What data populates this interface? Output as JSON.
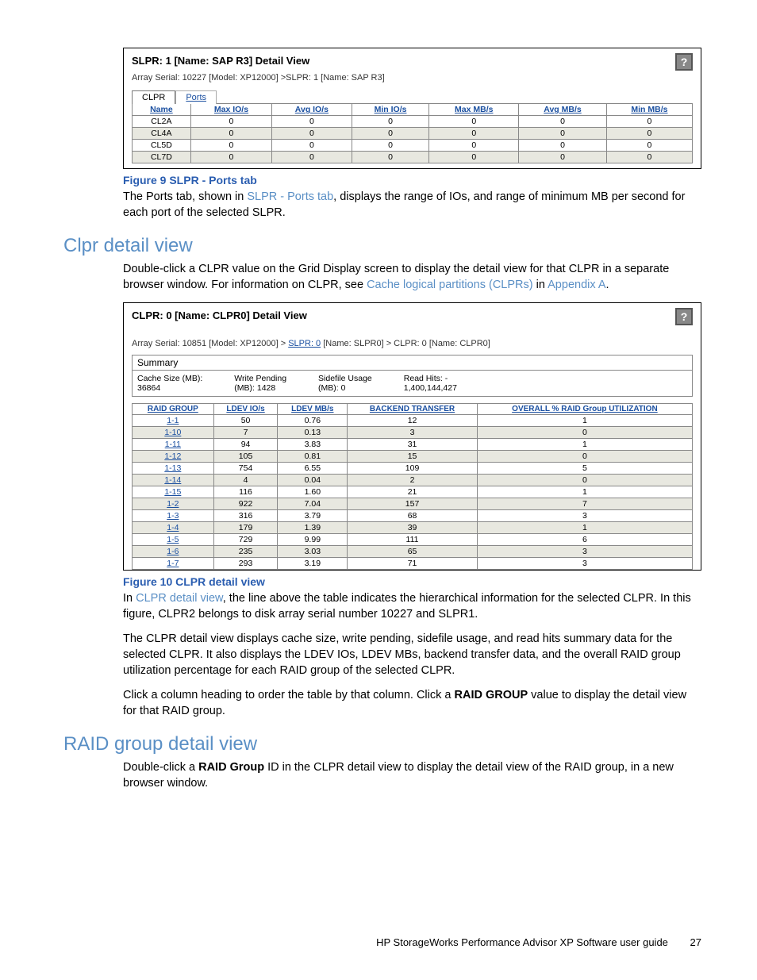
{
  "fig9": {
    "title": "SLPR: 1 [Name: SAP R3] Detail View",
    "breadcrumb": "Array Serial: 10227 [Model: XP12000] >SLPR: 1 [Name: SAP R3]",
    "tabs": {
      "active": "CLPR",
      "inactive": "Ports"
    },
    "headers": [
      "Name",
      "Max IO/s",
      "Avg IO/s",
      "Min IO/s",
      "Max MB/s",
      "Avg MB/s",
      "Min MB/s"
    ],
    "rows": [
      [
        "CL2A",
        "0",
        "0",
        "0",
        "0",
        "0",
        "0"
      ],
      [
        "CL4A",
        "0",
        "0",
        "0",
        "0",
        "0",
        "0"
      ],
      [
        "CL5D",
        "0",
        "0",
        "0",
        "0",
        "0",
        "0"
      ],
      [
        "CL7D",
        "0",
        "0",
        "0",
        "0",
        "0",
        "0"
      ]
    ],
    "caption": "Figure 9 SLPR - Ports tab",
    "desc_pre": "The Ports tab, shown in ",
    "desc_link": "SLPR - Ports tab",
    "desc_post": ", displays the range of IOs, and range of minimum MB per second for each port of the selected SLPR."
  },
  "section_clpr": {
    "heading": "Clpr detail view",
    "desc_pre": "Double-click a CLPR value on the Grid Display screen to display the detail view for that CLPR in a separate browser window. For information on CLPR, see ",
    "link1": "Cache logical partitions (CLPRs)",
    "mid": " in ",
    "link2": "Appendix A",
    "post": "."
  },
  "fig10": {
    "title": "CLPR: 0 [Name: CLPR0] Detail View",
    "breadcrumb_pre": "Array Serial: 10851 [Model: XP12000] > ",
    "breadcrumb_link": "SLPR: 0",
    "breadcrumb_post": " [Name: SLPR0] > CLPR: 0 [Name: CLPR0]",
    "summary_label": "Summary",
    "summary": {
      "cache_label": "Cache Size (MB):",
      "cache_val": "36864",
      "wp_label": "Write Pending",
      "wp_val": "(MB): 1428",
      "sf_label": "Sidefile Usage",
      "sf_val": "(MB): 0",
      "rh_label": "Read Hits: -",
      "rh_val": "1,400,144,427"
    },
    "headers": [
      "RAID GROUP",
      "LDEV IO/s",
      "LDEV MB/s",
      "BACKEND TRANSFER",
      "OVERALL % RAID Group UTILIZATION"
    ],
    "rows": [
      [
        "1-1",
        "50",
        "0.76",
        "12",
        "1"
      ],
      [
        "1-10",
        "7",
        "0.13",
        "3",
        "0"
      ],
      [
        "1-11",
        "94",
        "3.83",
        "31",
        "1"
      ],
      [
        "1-12",
        "105",
        "0.81",
        "15",
        "0"
      ],
      [
        "1-13",
        "754",
        "6.55",
        "109",
        "5"
      ],
      [
        "1-14",
        "4",
        "0.04",
        "2",
        "0"
      ],
      [
        "1-15",
        "116",
        "1.60",
        "21",
        "1"
      ],
      [
        "1-2",
        "922",
        "7.04",
        "157",
        "7"
      ],
      [
        "1-3",
        "316",
        "3.79",
        "68",
        "3"
      ],
      [
        "1-4",
        "179",
        "1.39",
        "39",
        "1"
      ],
      [
        "1-5",
        "729",
        "9.99",
        "111",
        "6"
      ],
      [
        "1-6",
        "235",
        "3.03",
        "65",
        "3"
      ],
      [
        "1-7",
        "293",
        "3.19",
        "71",
        "3"
      ]
    ],
    "caption": "Figure 10 CLPR detail view",
    "p1_pre": "In ",
    "p1_link": "CLPR detail view",
    "p1_post": ", the line above the table indicates the hierarchical information for the selected CLPR. In this figure, CLPR2 belongs to disk array serial number 10227 and SLPR1.",
    "p2": "The CLPR detail view displays cache size, write pending, sidefile usage, and read hits summary data for the selected CLPR. It also displays the LDEV IOs, LDEV MBs, backend transfer data, and the overall RAID group utilization percentage for each RAID group of the selected CLPR.",
    "p3_pre": "Click a column heading to order the table by that column. Click a ",
    "p3_bold": "RAID GROUP",
    "p3_post": " value to display the detail view for that RAID group."
  },
  "section_raid": {
    "heading": "RAID group detail view",
    "desc_pre": "Double-click a ",
    "desc_bold": "RAID Group",
    "desc_post": " ID in the CLPR detail view to display the detail view of the RAID group, in a new browser window."
  },
  "footer": {
    "text": "HP StorageWorks Performance Advisor XP Software user guide",
    "page": "27"
  }
}
